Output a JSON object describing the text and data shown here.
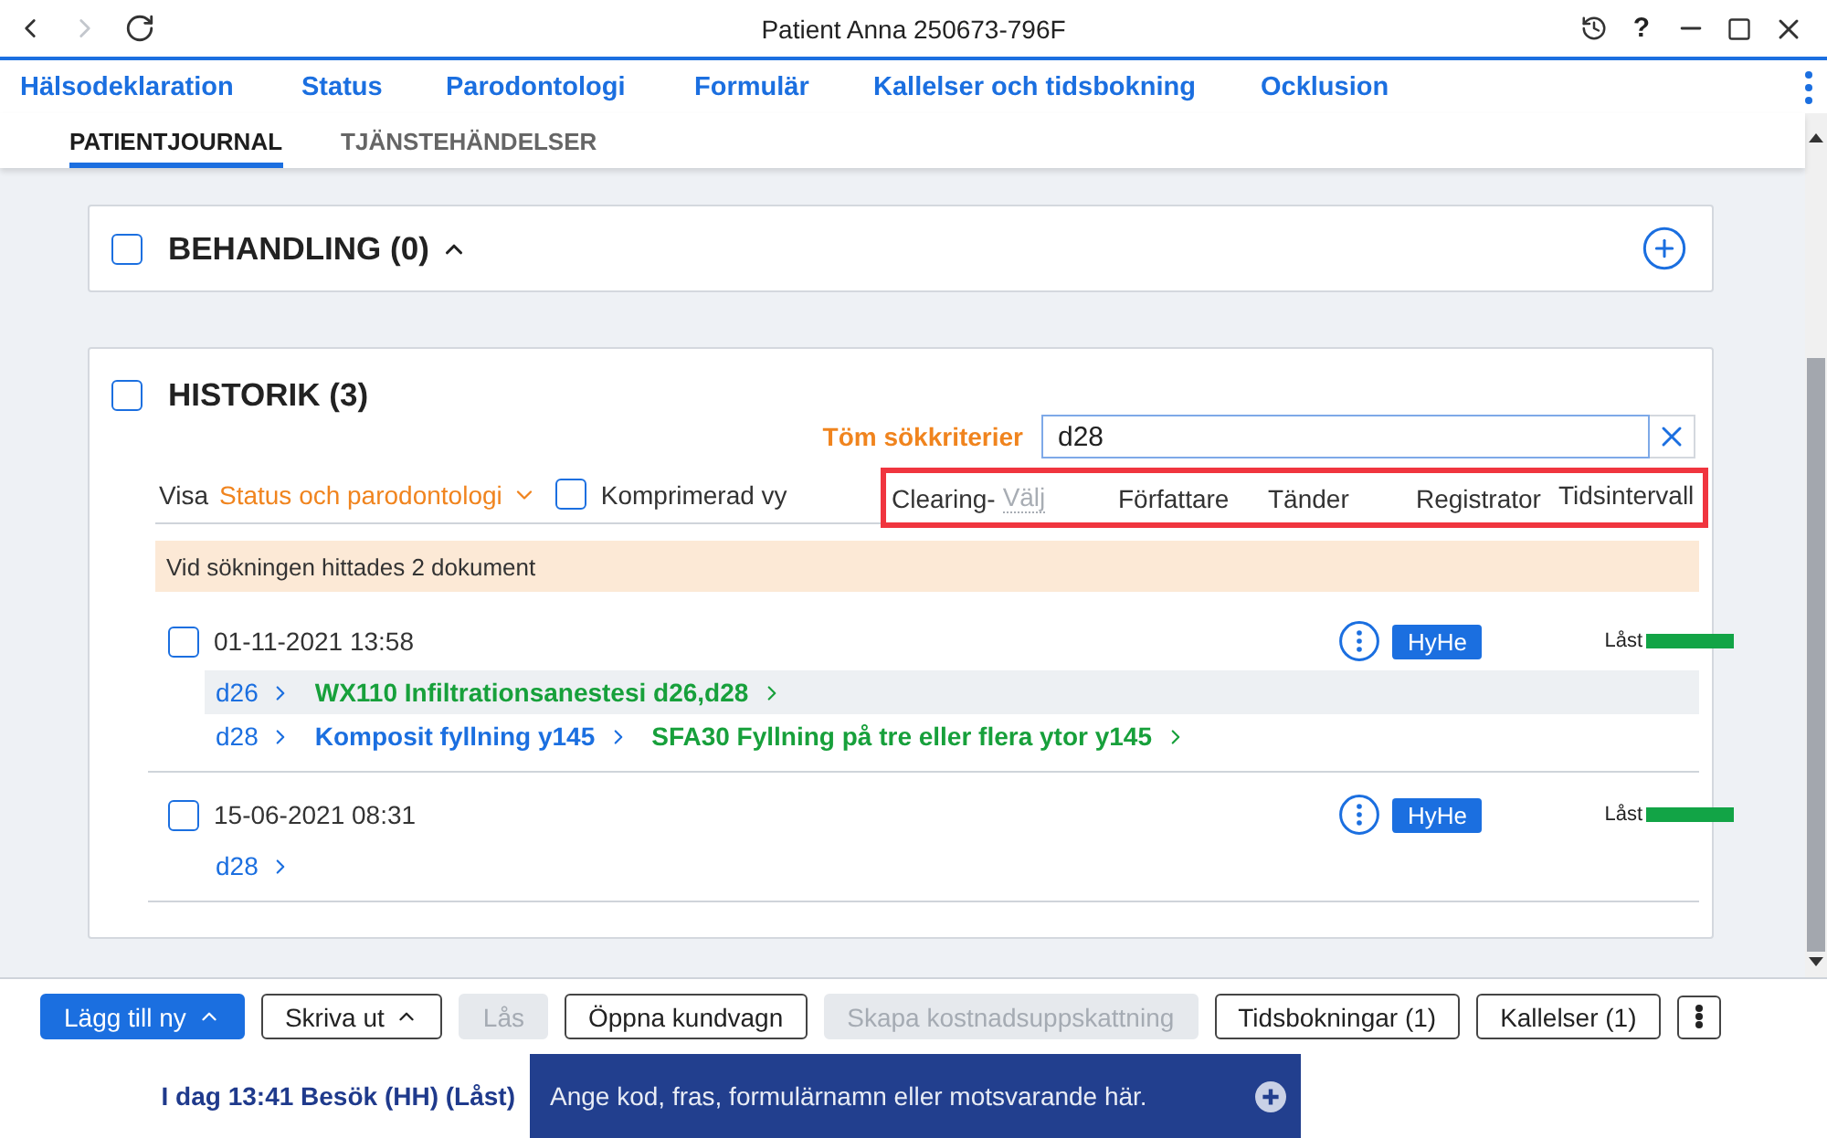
{
  "window": {
    "title": "Patient Anna 250673-796F",
    "nav_buttons": [
      {
        "kind": "back",
        "disabled": false
      },
      {
        "kind": "forward",
        "disabled": true
      },
      {
        "kind": "reload",
        "disabled": false
      }
    ],
    "help": "?"
  },
  "nav_tabs": [
    "Hälsodeklaration",
    "Status",
    "Parodontologi",
    "Formulär",
    "Kallelser och tidsbokning",
    "Ocklusion"
  ],
  "sub_tabs": [
    {
      "label": "PATIENTJOURNAL",
      "selected": true
    },
    {
      "label": "TJÄNSTEHÄNDELSER",
      "selected": false
    }
  ],
  "behandling": {
    "title": "BEHANDLING (0)",
    "checked": false,
    "expanded": true
  },
  "historik": {
    "title": "HISTORIK (3)",
    "checked": false,
    "clear_criteria": "Töm sökkriterier",
    "search": {
      "value": "d28"
    },
    "view_label": "Visa",
    "view_select": "Status och parodontologi",
    "compact": {
      "label": "Komprimerad vy",
      "checked": false
    },
    "filters": {
      "highlighted": true,
      "items": [
        {
          "label": "Clearing-",
          "placeholder": "Välj"
        },
        {
          "label": "Författare"
        },
        {
          "label": "Tänder"
        },
        {
          "label": "Registrator"
        },
        {
          "label": "Tidsintervall"
        }
      ]
    },
    "result_note": "Vid sökningen hittades 2 dokument",
    "entries": [
      {
        "checked": false,
        "date": "01-11-2021 13:58",
        "signature": "HyHe",
        "status": {
          "label": "Låst",
          "color": "#12a446"
        },
        "lines": [
          {
            "highlighted": true,
            "links": [
              {
                "kind": "tooth",
                "text": "d26"
              },
              {
                "kind": "procedure",
                "text": "WX110 Infiltrationsanestesi d26,d28"
              }
            ]
          },
          {
            "highlighted": false,
            "links": [
              {
                "kind": "tooth",
                "text": "d28"
              },
              {
                "kind": "group",
                "text": "Komposit fyllning y145"
              },
              {
                "kind": "procedure",
                "text": "SFA30 Fyllning på tre eller flera ytor y145"
              }
            ]
          }
        ]
      },
      {
        "checked": false,
        "date": "15-06-2021 08:31",
        "signature": "HyHe",
        "status": {
          "label": "Låst",
          "color": "#12a446"
        },
        "lines": [
          {
            "highlighted": false,
            "links": [
              {
                "kind": "tooth",
                "text": "d28"
              }
            ]
          }
        ]
      }
    ]
  },
  "toolbar": {
    "buttons": [
      {
        "label": "Lägg till ny",
        "primary": true,
        "disabled": false,
        "menu": true
      },
      {
        "label": "Skriva ut",
        "primary": false,
        "disabled": false,
        "menu": true
      },
      {
        "label": "Lås",
        "primary": false,
        "disabled": true,
        "menu": false
      },
      {
        "label": "Öppna kundvagn",
        "primary": false,
        "disabled": false,
        "menu": false
      },
      {
        "label": "Skapa kostnadsuppskattning",
        "primary": false,
        "disabled": true,
        "menu": false
      },
      {
        "label": "Tidsbokningar (1)",
        "primary": false,
        "disabled": false,
        "menu": false
      },
      {
        "label": "Kallelser (1)",
        "primary": false,
        "disabled": false,
        "menu": false
      }
    ]
  },
  "status_bar": {
    "visit": "I dag 13:41 Besök (HH) (Låst)",
    "command": {
      "placeholder": "Ange kod, fras, formulärnamn eller motsvarande här."
    }
  }
}
